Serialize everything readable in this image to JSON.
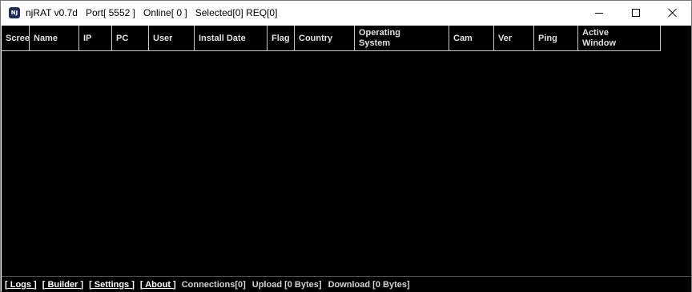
{
  "window": {
    "app_name": "njRAT v0.7d",
    "port": "Port[ 5552 ]",
    "online": "Online[ 0 ]",
    "selected": "Selected[0] REQ[0]",
    "icon_letters": "NJ"
  },
  "columns": [
    {
      "key": "screen",
      "label": "Screen"
    },
    {
      "key": "name",
      "label": "Name"
    },
    {
      "key": "ip",
      "label": "IP"
    },
    {
      "key": "pc",
      "label": "PC"
    },
    {
      "key": "user",
      "label": "User"
    },
    {
      "key": "install_date",
      "label": "Install Date"
    },
    {
      "key": "flag",
      "label": "Flag"
    },
    {
      "key": "country",
      "label": "Country"
    },
    {
      "key": "os",
      "label": "Operating\nSystem"
    },
    {
      "key": "cam",
      "label": "Cam"
    },
    {
      "key": "ver",
      "label": "Ver"
    },
    {
      "key": "ping",
      "label": "Ping"
    },
    {
      "key": "active_window",
      "label": "Active\nWindow"
    }
  ],
  "statusbar": {
    "logs": "[ Logs ]",
    "builder": "[ Builder ]",
    "settings": "[ Settings ]",
    "about": "[ About ]",
    "connections": "Connections[0]",
    "upload": "Upload [0 Bytes]",
    "download": "Download [0 Bytes]"
  },
  "colors": {
    "list_background": "#000000",
    "header_text": "#e0e0e0",
    "grid_line": "#c8c8c8"
  }
}
